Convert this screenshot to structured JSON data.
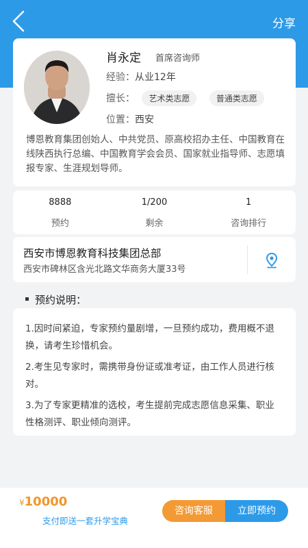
{
  "header": {
    "share_label": "分享",
    "back_icon": "chevron-left-icon"
  },
  "profile": {
    "name": "肖永定",
    "title": "首席咨询师",
    "experience_label": "经验：",
    "experience_value": "从业12年",
    "specialty_label": "擅长：",
    "specialties": [
      "艺术类志愿",
      "普通类志愿"
    ],
    "location_label": "位置：",
    "location_value": "西安",
    "bio": "博恩教育集团创始人、中共党员、原高校招办主任、中国教育在线陕西执行总编、中国教育学会会员、国家就业指导师、志愿填报专家、生涯规划导师。"
  },
  "stats": [
    {
      "value": "8888",
      "label": "预约"
    },
    {
      "value": "1/200",
      "label": "剩余"
    },
    {
      "value": "1",
      "label": "咨询排行"
    }
  ],
  "address": {
    "org": "西安市博恩教育科技集团总部",
    "line": "西安市碑林区含光北路文华商务大厦33号",
    "icon": "location-pin-icon"
  },
  "notes": {
    "title": "预约说明：",
    "items": [
      "1.因时间紧迫，专家预约量剧增，一旦预约成功，费用概不退换，请考生珍惜机会。",
      "2.考生见专家时，需携带身份证或准考证，由工作人员进行核对。",
      "3.为了专家更精准的选校，考生提前完成志愿信息采集、职业性格测评、职业倾向测评。"
    ]
  },
  "bottom": {
    "currency": "¥",
    "price": "10000",
    "gift": "支付即送一套升学宝典",
    "consult_label": "咨询客服",
    "book_label": "立即预约"
  },
  "colors": {
    "primary": "#2d9ae8",
    "accent": "#f39a35",
    "price": "#f0962a"
  }
}
